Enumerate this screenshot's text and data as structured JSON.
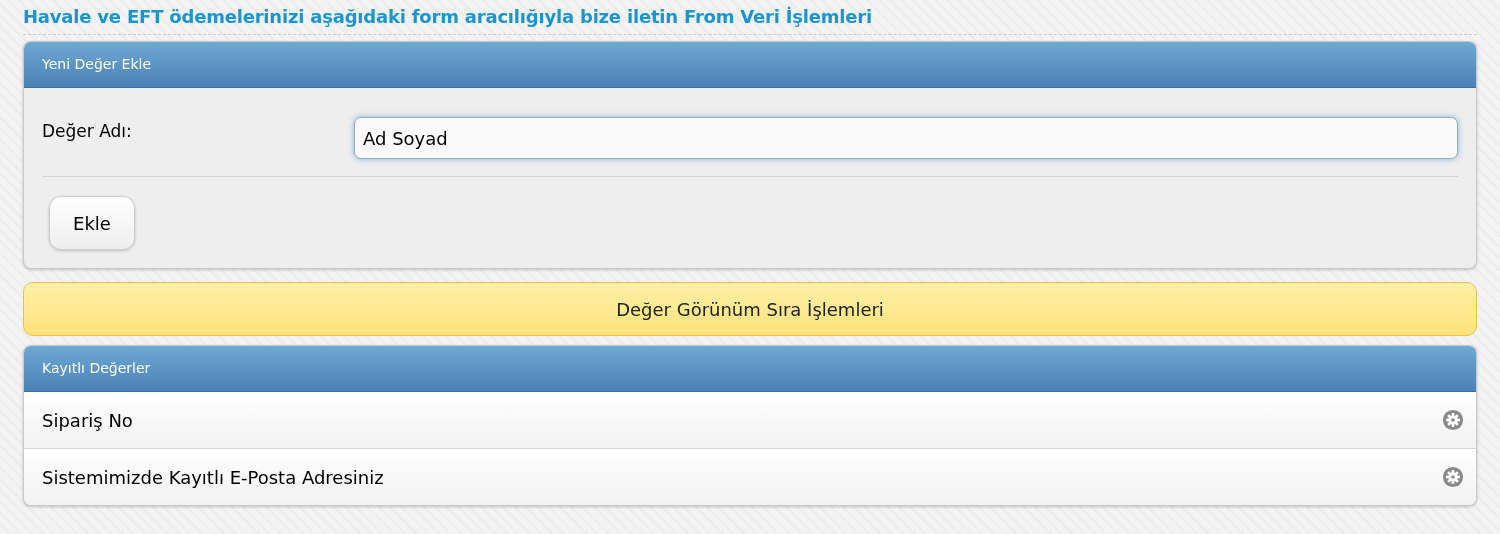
{
  "page_title": "Havale ve EFT ödemelerinizi aşağıdaki form aracılığıyla bize iletin From Veri İşlemleri",
  "add_panel": {
    "title": "Yeni Değer Ekle",
    "field_label": "Değer Adı:",
    "field_value": "Ad Soyad",
    "button": "Ekle"
  },
  "order_bar": {
    "label": "Değer Görünüm Sıra İşlemleri"
  },
  "saved_panel": {
    "title": "Kayıtlı Değerler",
    "items": [
      {
        "label": "Sipariş No"
      },
      {
        "label": "Sistemimizde Kayıtlı E-Posta Adresiniz"
      }
    ]
  }
}
